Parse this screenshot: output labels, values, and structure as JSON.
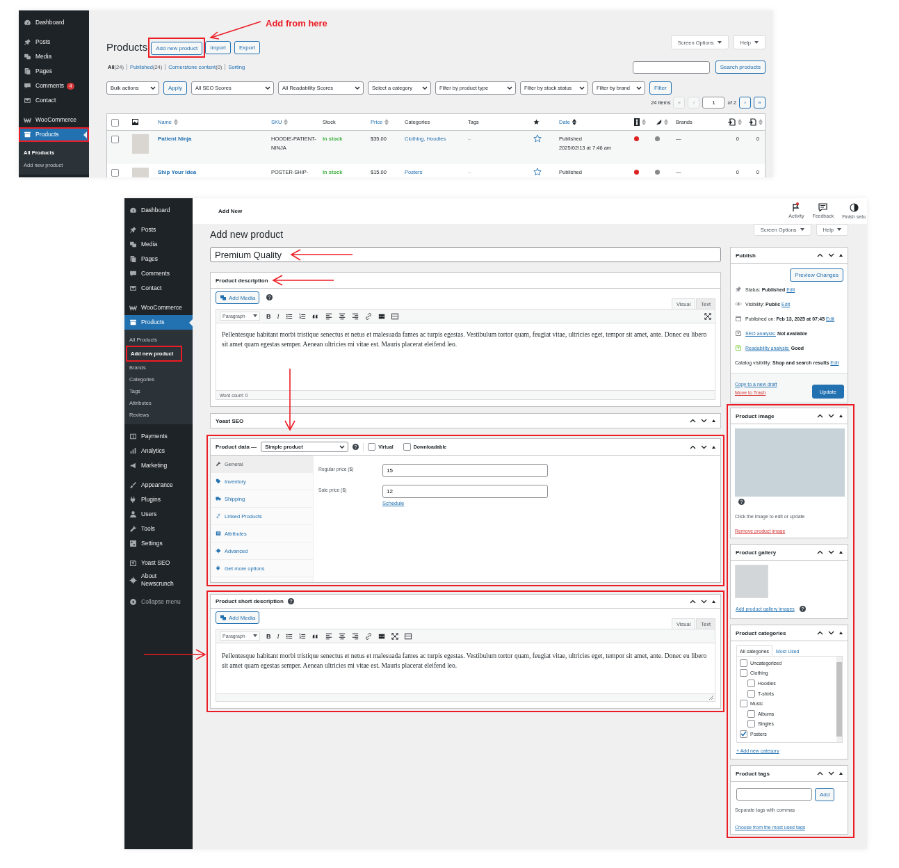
{
  "annotation": {
    "label": "Add from here"
  },
  "products_list": {
    "sidebar": {
      "groups": [
        {
          "items": [
            {
              "label": "Dashboard",
              "selected": false,
              "highlighted": false
            }
          ]
        },
        {
          "items": [
            {
              "label": "Posts",
              "selected": false,
              "highlighted": false
            },
            {
              "label": "Media",
              "selected": false,
              "highlighted": false
            },
            {
              "label": "Pages",
              "selected": false,
              "highlighted": false
            },
            {
              "label": "Comments",
              "badge": "4",
              "selected": false,
              "highlighted": false
            },
            {
              "label": "Contact",
              "selected": false,
              "highlighted": false
            }
          ]
        },
        {
          "items": [
            {
              "label": "WooCommerce",
              "selected": false,
              "highlighted": false
            },
            {
              "label": "Products",
              "selected": true,
              "highlighted": true,
              "children": [
                {
                  "label": "All Products",
                  "selected": true,
                  "highlighted": false
                },
                {
                  "label": "Add new product",
                  "selected": false,
                  "highlighted": false
                }
              ]
            }
          ]
        }
      ]
    },
    "title": "Products",
    "header_buttons": [
      {
        "label": "Add new product",
        "highlighted": true
      },
      {
        "label": "Import",
        "highlighted": false
      },
      {
        "label": "Export",
        "highlighted": false
      }
    ],
    "screen_options": "Screen Options",
    "help": "Help",
    "views": [
      {
        "label": "All",
        "count": "(24)",
        "selected": true
      },
      {
        "label": "Published",
        "count": "(24)",
        "selected": false
      },
      {
        "label": "Cornerstone content",
        "count": "(0)",
        "selected": false
      },
      {
        "label": "Sorting",
        "selected": false
      }
    ],
    "search_button": "Search products",
    "bulk_action": "Bulk actions",
    "apply_button": "Apply",
    "filters": [
      "All SEO Scores",
      "All Readability Scores",
      "Select a category",
      "Filter by product type",
      "Filter by stock status",
      "Filter by brand"
    ],
    "filter_button": "Filter",
    "pagination": {
      "count": "24 items",
      "prev_buttons": [
        {
          "label": "«",
          "disabled": true
        },
        {
          "label": "‹",
          "disabled": true
        }
      ],
      "page": "1",
      "total": "of 2",
      "next_buttons": [
        {
          "label": "›",
          "disabled": false
        },
        {
          "label": "»",
          "disabled": false
        }
      ]
    },
    "table": {
      "columns": [
        {
          "kind": "checkbox",
          "checked": false
        },
        {
          "kind": "thumbnail"
        },
        {
          "kind": "text",
          "label": "Name",
          "sortable": true
        },
        {
          "kind": "text",
          "label": "SKU",
          "sortable": true
        },
        {
          "kind": "text",
          "label": "Stock",
          "sortable": false
        },
        {
          "kind": "text",
          "label": "Price",
          "sortable": true
        },
        {
          "kind": "text",
          "label": "Categories",
          "sortable": false
        },
        {
          "kind": "text",
          "label": "Tags",
          "sortable": false
        },
        {
          "kind": "star"
        },
        {
          "kind": "text",
          "label": "Date",
          "sortable": true
        },
        {
          "kind": "seo",
          "sortable": true
        },
        {
          "kind": "readability",
          "sortable": true
        },
        {
          "kind": "text",
          "label": "Brands",
          "sortable": false
        },
        {
          "kind": "links_in",
          "sortable": true
        },
        {
          "kind": "links_out",
          "sortable": true
        }
      ],
      "rows": [
        {
          "checked": false,
          "name": "Patient Ninja",
          "sku": "HOODIE-PATIENT-NINJA",
          "stock": "In stock",
          "price": "$35.00",
          "categories": "Clothing, Hoodies",
          "tags": "–",
          "featured": false,
          "status": "Published",
          "date": "2025/02/13 at 7:46 am",
          "seo": {
            "color": "#dd2222"
          },
          "readability": {
            "color": "#888888"
          },
          "brands": "—",
          "links_in": "0",
          "links_out": "0"
        },
        {
          "checked": false,
          "name": "Ship Your Idea",
          "sku": "POSTER-SHIP-",
          "stock": "In stock",
          "price": "$15.00",
          "categories": "Posters",
          "tags": "–",
          "featured": false,
          "status": "Published",
          "seo": {
            "color": "#dd2222"
          },
          "readability": {
            "color": "#888888"
          },
          "brands": "—",
          "links_in": "0",
          "links_out": "0"
        }
      ]
    }
  },
  "editor": {
    "sidebar": {
      "groups": [
        {
          "items": [
            {
              "label": "Dashboard",
              "selected": false,
              "highlighted": false
            }
          ]
        },
        {
          "items": [
            {
              "label": "Posts",
              "selected": false,
              "highlighted": false
            },
            {
              "label": "Media",
              "selected": false,
              "highlighted": false
            },
            {
              "label": "Pages",
              "selected": false,
              "highlighted": false
            },
            {
              "label": "Comments",
              "selected": false,
              "highlighted": false
            },
            {
              "label": "Contact",
              "selected": false,
              "highlighted": false
            }
          ]
        },
        {
          "items": [
            {
              "label": "WooCommerce",
              "selected": false,
              "highlighted": false
            },
            {
              "label": "Products",
              "selected": true,
              "highlighted": false,
              "children": [
                {
                  "label": "All Products",
                  "selected": false,
                  "highlighted": false
                },
                {
                  "label": "Add new product",
                  "selected": true,
                  "highlighted": true
                },
                {
                  "label": "Brands",
                  "selected": false,
                  "highlighted": false
                },
                {
                  "label": "Categories",
                  "selected": false,
                  "highlighted": false
                },
                {
                  "label": "Tags",
                  "selected": false,
                  "highlighted": false
                },
                {
                  "label": "Attributes",
                  "selected": false,
                  "highlighted": false
                },
                {
                  "label": "Reviews",
                  "selected": false,
                  "highlighted": false
                }
              ]
            }
          ]
        },
        {
          "items": [
            {
              "label": "Payments",
              "selected": false,
              "highlighted": false
            },
            {
              "label": "Analytics",
              "selected": false,
              "highlighted": false
            },
            {
              "label": "Marketing",
              "selected": false,
              "highlighted": false
            }
          ]
        },
        {
          "items": [
            {
              "label": "Appearance",
              "selected": false,
              "highlighted": false
            },
            {
              "label": "Plugins",
              "selected": false,
              "highlighted": false
            },
            {
              "label": "Users",
              "selected": false,
              "highlighted": false
            },
            {
              "label": "Tools",
              "selected": false,
              "highlighted": false
            },
            {
              "label": "Settings",
              "selected": false,
              "highlighted": false
            }
          ]
        },
        {
          "items": [
            {
              "label": "Yoast SEO",
              "selected": false,
              "highlighted": false
            },
            {
              "label": "About Newscrunch",
              "selected": false,
              "highlighted": false
            }
          ]
        }
      ],
      "collapse_label": "Collapse menu"
    },
    "topbar": {
      "title": "Add New",
      "actions": [
        {
          "label": "Activity",
          "kind": "flag",
          "notification": true
        },
        {
          "label": "Feedback",
          "kind": "feedback",
          "notification": false
        },
        {
          "label": "Finish setu",
          "kind": "progress",
          "notification": false
        }
      ]
    },
    "screen_options": "Screen Options",
    "help": "Help",
    "title": "Add new product",
    "product_title": "Premium Quality",
    "description": {
      "title": "Product description",
      "add_media": "Add Media",
      "tabs": [
        {
          "label": "Visual",
          "selected": true
        },
        {
          "label": "Text",
          "selected": false
        }
      ],
      "format": "Paragraph",
      "toolbar": [
        {
          "kind": "bold",
          "label": "B"
        },
        {
          "kind": "italic",
          "label": "I"
        },
        {
          "kind": "bullets"
        },
        {
          "kind": "numbers"
        },
        {
          "kind": "quote"
        },
        {
          "kind": "align_left"
        },
        {
          "kind": "align_center"
        },
        {
          "kind": "align_right"
        },
        {
          "kind": "link"
        },
        {
          "kind": "more"
        },
        {
          "kind": "toggle"
        }
      ],
      "toolbar_right": [
        {
          "kind": "fullscreen"
        }
      ],
      "content": "Pellentesque habitant morbi tristique senectus et netus et malesuada fames ac turpis egestas. Vestibulum tortor quam, feugiat vitae, ultricies eget, tempor sit amet, ante. Donec eu libero sit amet quam egestas semper. Aenean ultricies mi vitae est. Mauris placerat eleifend leo.",
      "word_count": "Word count: 0"
    },
    "yoast": {
      "title": "Yoast SEO"
    },
    "product_data": {
      "highlighted": true,
      "title": "Product data —",
      "type": "Simple product",
      "options": [
        {
          "label": "Virtual",
          "checked": false
        },
        {
          "label": "Downloadable",
          "checked": false
        }
      ],
      "tabs": [
        {
          "label": "General",
          "selected": true
        },
        {
          "label": "Inventory",
          "selected": false
        },
        {
          "label": "Shipping",
          "selected": false
        },
        {
          "label": "Linked Products",
          "selected": false
        },
        {
          "label": "Attributes",
          "selected": false
        },
        {
          "label": "Advanced",
          "selected": false
        },
        {
          "label": "Get more options",
          "selected": false
        }
      ],
      "fields": [
        {
          "label": "Regular price ($)",
          "value": "15"
        },
        {
          "label": "Sale price ($)",
          "value": "12",
          "link": "Schedule"
        }
      ]
    },
    "short_description": {
      "highlighted": true,
      "title": "Product short description",
      "add_media": "Add Media",
      "tabs": [
        {
          "label": "Visual",
          "selected": true
        },
        {
          "label": "Text",
          "selected": false
        }
      ],
      "format": "Paragraph",
      "toolbar": [
        {
          "kind": "bold",
          "label": "B"
        },
        {
          "kind": "italic",
          "label": "I"
        },
        {
          "kind": "bullets"
        },
        {
          "kind": "numbers"
        },
        {
          "kind": "quote"
        },
        {
          "kind": "align_left"
        },
        {
          "kind": "align_center"
        },
        {
          "kind": "align_right"
        },
        {
          "kind": "link"
        },
        {
          "kind": "more"
        },
        {
          "kind": "fullscreen"
        },
        {
          "kind": "toggle"
        }
      ],
      "content": "Pellentesque habitant morbi tristique senectus et netus et malesuada fames ac turpis egestas. Vestibulum tortor quam, feugiat vitae, ultricies eget, tempor sit amet, ante. Donec eu libero sit amet quam egestas semper. Aenean ultricies mi vitae est. Mauris placerat eleifend leo."
    },
    "publish": {
      "title": "Publish",
      "preview_button": "Preview Changes",
      "rows": [
        {
          "kind": "status",
          "label": "Status:",
          "value": "Published",
          "link": "Edit"
        },
        {
          "kind": "visibility",
          "label": "Visibility:",
          "value": "Public",
          "link": "Edit"
        },
        {
          "kind": "calendar",
          "label": "Published on:",
          "value": "Feb 13, 2025 at 07:45",
          "link": "Edit"
        },
        {
          "kind": "seo",
          "link": "SEO analysis:",
          "value": "Not available",
          "color": "#888888"
        },
        {
          "kind": "readability",
          "link": "Readability analysis:",
          "value": "Good",
          "color": "#7ad03a"
        },
        {
          "kind": "catalog",
          "label": "Catalog visibility:",
          "value": "Shop and search results",
          "link": "Edit"
        }
      ],
      "copy_link": "Copy to a new draft",
      "trash_link": "Move to Trash",
      "update_button": "Update"
    },
    "side_panels": {
      "highlighted": true,
      "image": {
        "title": "Product image",
        "hint": "Click the image to edit or update",
        "remove_link": "Remove product image"
      },
      "gallery": {
        "title": "Product gallery",
        "add_link": "Add product gallery images"
      },
      "categories": {
        "title": "Product categories",
        "tabs": [
          {
            "label": "All categories",
            "selected": true
          },
          {
            "label": "Most Used",
            "selected": false
          }
        ],
        "items": [
          {
            "label": "Uncategorized",
            "checked": false
          },
          {
            "label": "Clothing",
            "checked": false,
            "children": [
              {
                "label": "Hoodies",
                "checked": false
              },
              {
                "label": "T-shirts",
                "checked": false
              }
            ]
          },
          {
            "label": "Music",
            "checked": false,
            "children": [
              {
                "label": "Albums",
                "checked": false
              },
              {
                "label": "Singles",
                "checked": false
              }
            ]
          },
          {
            "label": "Posters",
            "checked": true
          }
        ],
        "add_link": "+ Add new category"
      },
      "tags": {
        "title": "Product tags",
        "add_button": "Add",
        "hint": "Separate tags with commas",
        "choose_link": "Choose from the most used tags"
      }
    }
  }
}
